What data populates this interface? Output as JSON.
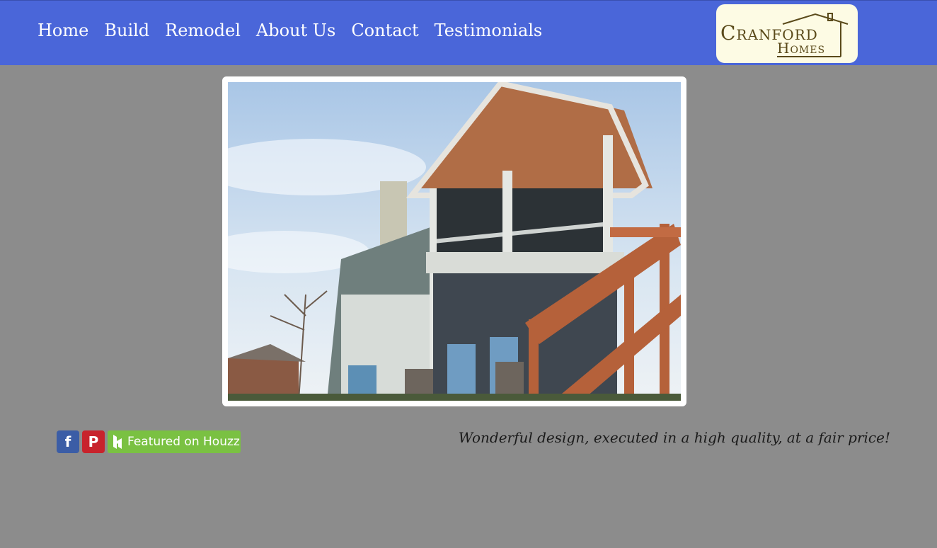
{
  "nav": {
    "items": [
      {
        "label": "Home"
      },
      {
        "label": "Build"
      },
      {
        "label": "Remodel"
      },
      {
        "label": "About Us"
      },
      {
        "label": "Contact"
      },
      {
        "label": "Testimonials"
      }
    ]
  },
  "logo": {
    "line1": "Cranford",
    "line2": "Homes",
    "icon": "house-outline-icon"
  },
  "social": {
    "facebook_icon": "facebook-icon",
    "facebook_glyph": "f",
    "pinterest_icon": "pinterest-icon",
    "pinterest_glyph": "P",
    "houzz_label": "Featured on Houzz",
    "houzz_icon": "houzz-icon"
  },
  "tagline": "Wonderful design, executed in a high quality, at a fair price!",
  "colors": {
    "header_bg": "#4a66d9",
    "page_bg": "#8c8c8c",
    "logo_bg": "#fdfbe4",
    "facebook": "#3b5da6",
    "pinterest": "#c8232c",
    "houzz": "#7ac142"
  }
}
